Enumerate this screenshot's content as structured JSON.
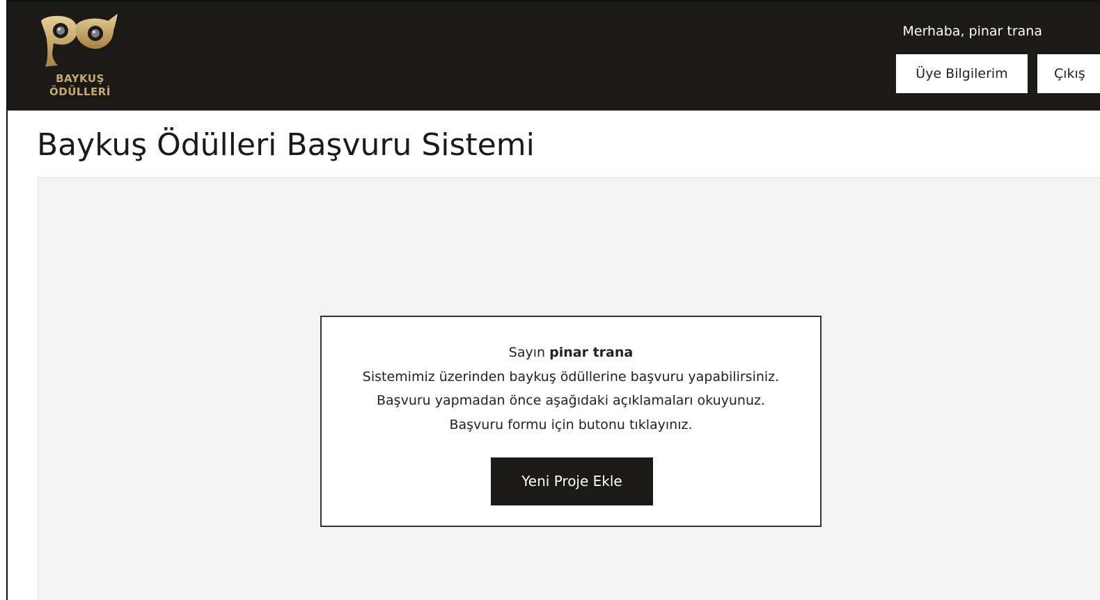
{
  "header": {
    "logo_line1": "BAYKUŞ",
    "logo_line2": "ÖDÜLLERİ",
    "greeting": "Merhaba, pinar trana",
    "profile_button": "Üye Bilgilerim",
    "logout_button": "Çıkış",
    "brand_color": "#c9a96b",
    "background_color": "#1c1a17"
  },
  "page": {
    "title": "Baykuş Ödülleri Başvuru Sistemi"
  },
  "welcome": {
    "salutation": "Sayın",
    "user_name": "pinar trana",
    "line1": "Sistemimiz üzerinden baykuş ödüllerine başvuru yapabilirsiniz.",
    "line2": "Başvuru yapmadan önce aşağıdaki açıklamaları okuyunuz.",
    "line3": "Başvuru formu için butonu tıklayınız.",
    "button": "Yeni Proje Ekle"
  }
}
